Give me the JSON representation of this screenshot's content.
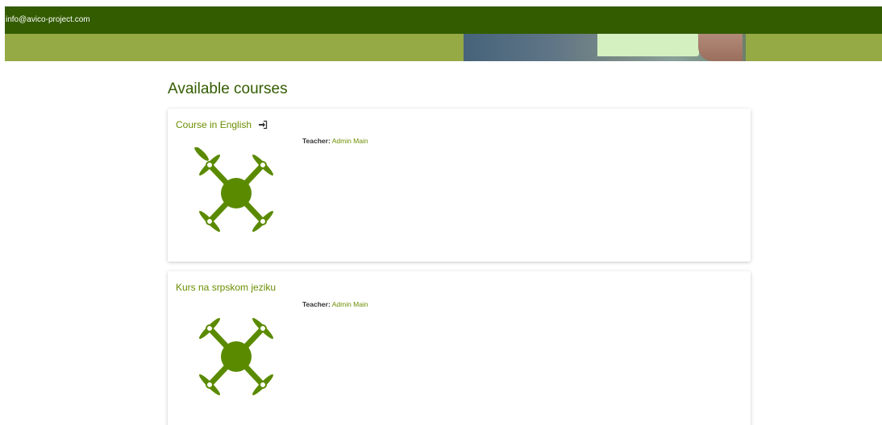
{
  "header": {
    "email": "info@avico-project.com"
  },
  "main": {
    "title": "Available courses",
    "courses": [
      {
        "title": "Course in English",
        "teacher_label": "Teacher:",
        "teacher_name": "Admin Main",
        "has_enter_icon": true
      },
      {
        "title": "Kurs na srpskom jeziku",
        "teacher_label": "Teacher:",
        "teacher_name": "Admin Main",
        "has_enter_icon": false
      }
    ]
  },
  "colors": {
    "topbar": "#335c00",
    "banner": "#95a945",
    "accent": "#6b8e00",
    "drone": "#5a8a00"
  },
  "icons": {
    "enter": "sign-in-icon",
    "course_image": "drone-icon"
  }
}
